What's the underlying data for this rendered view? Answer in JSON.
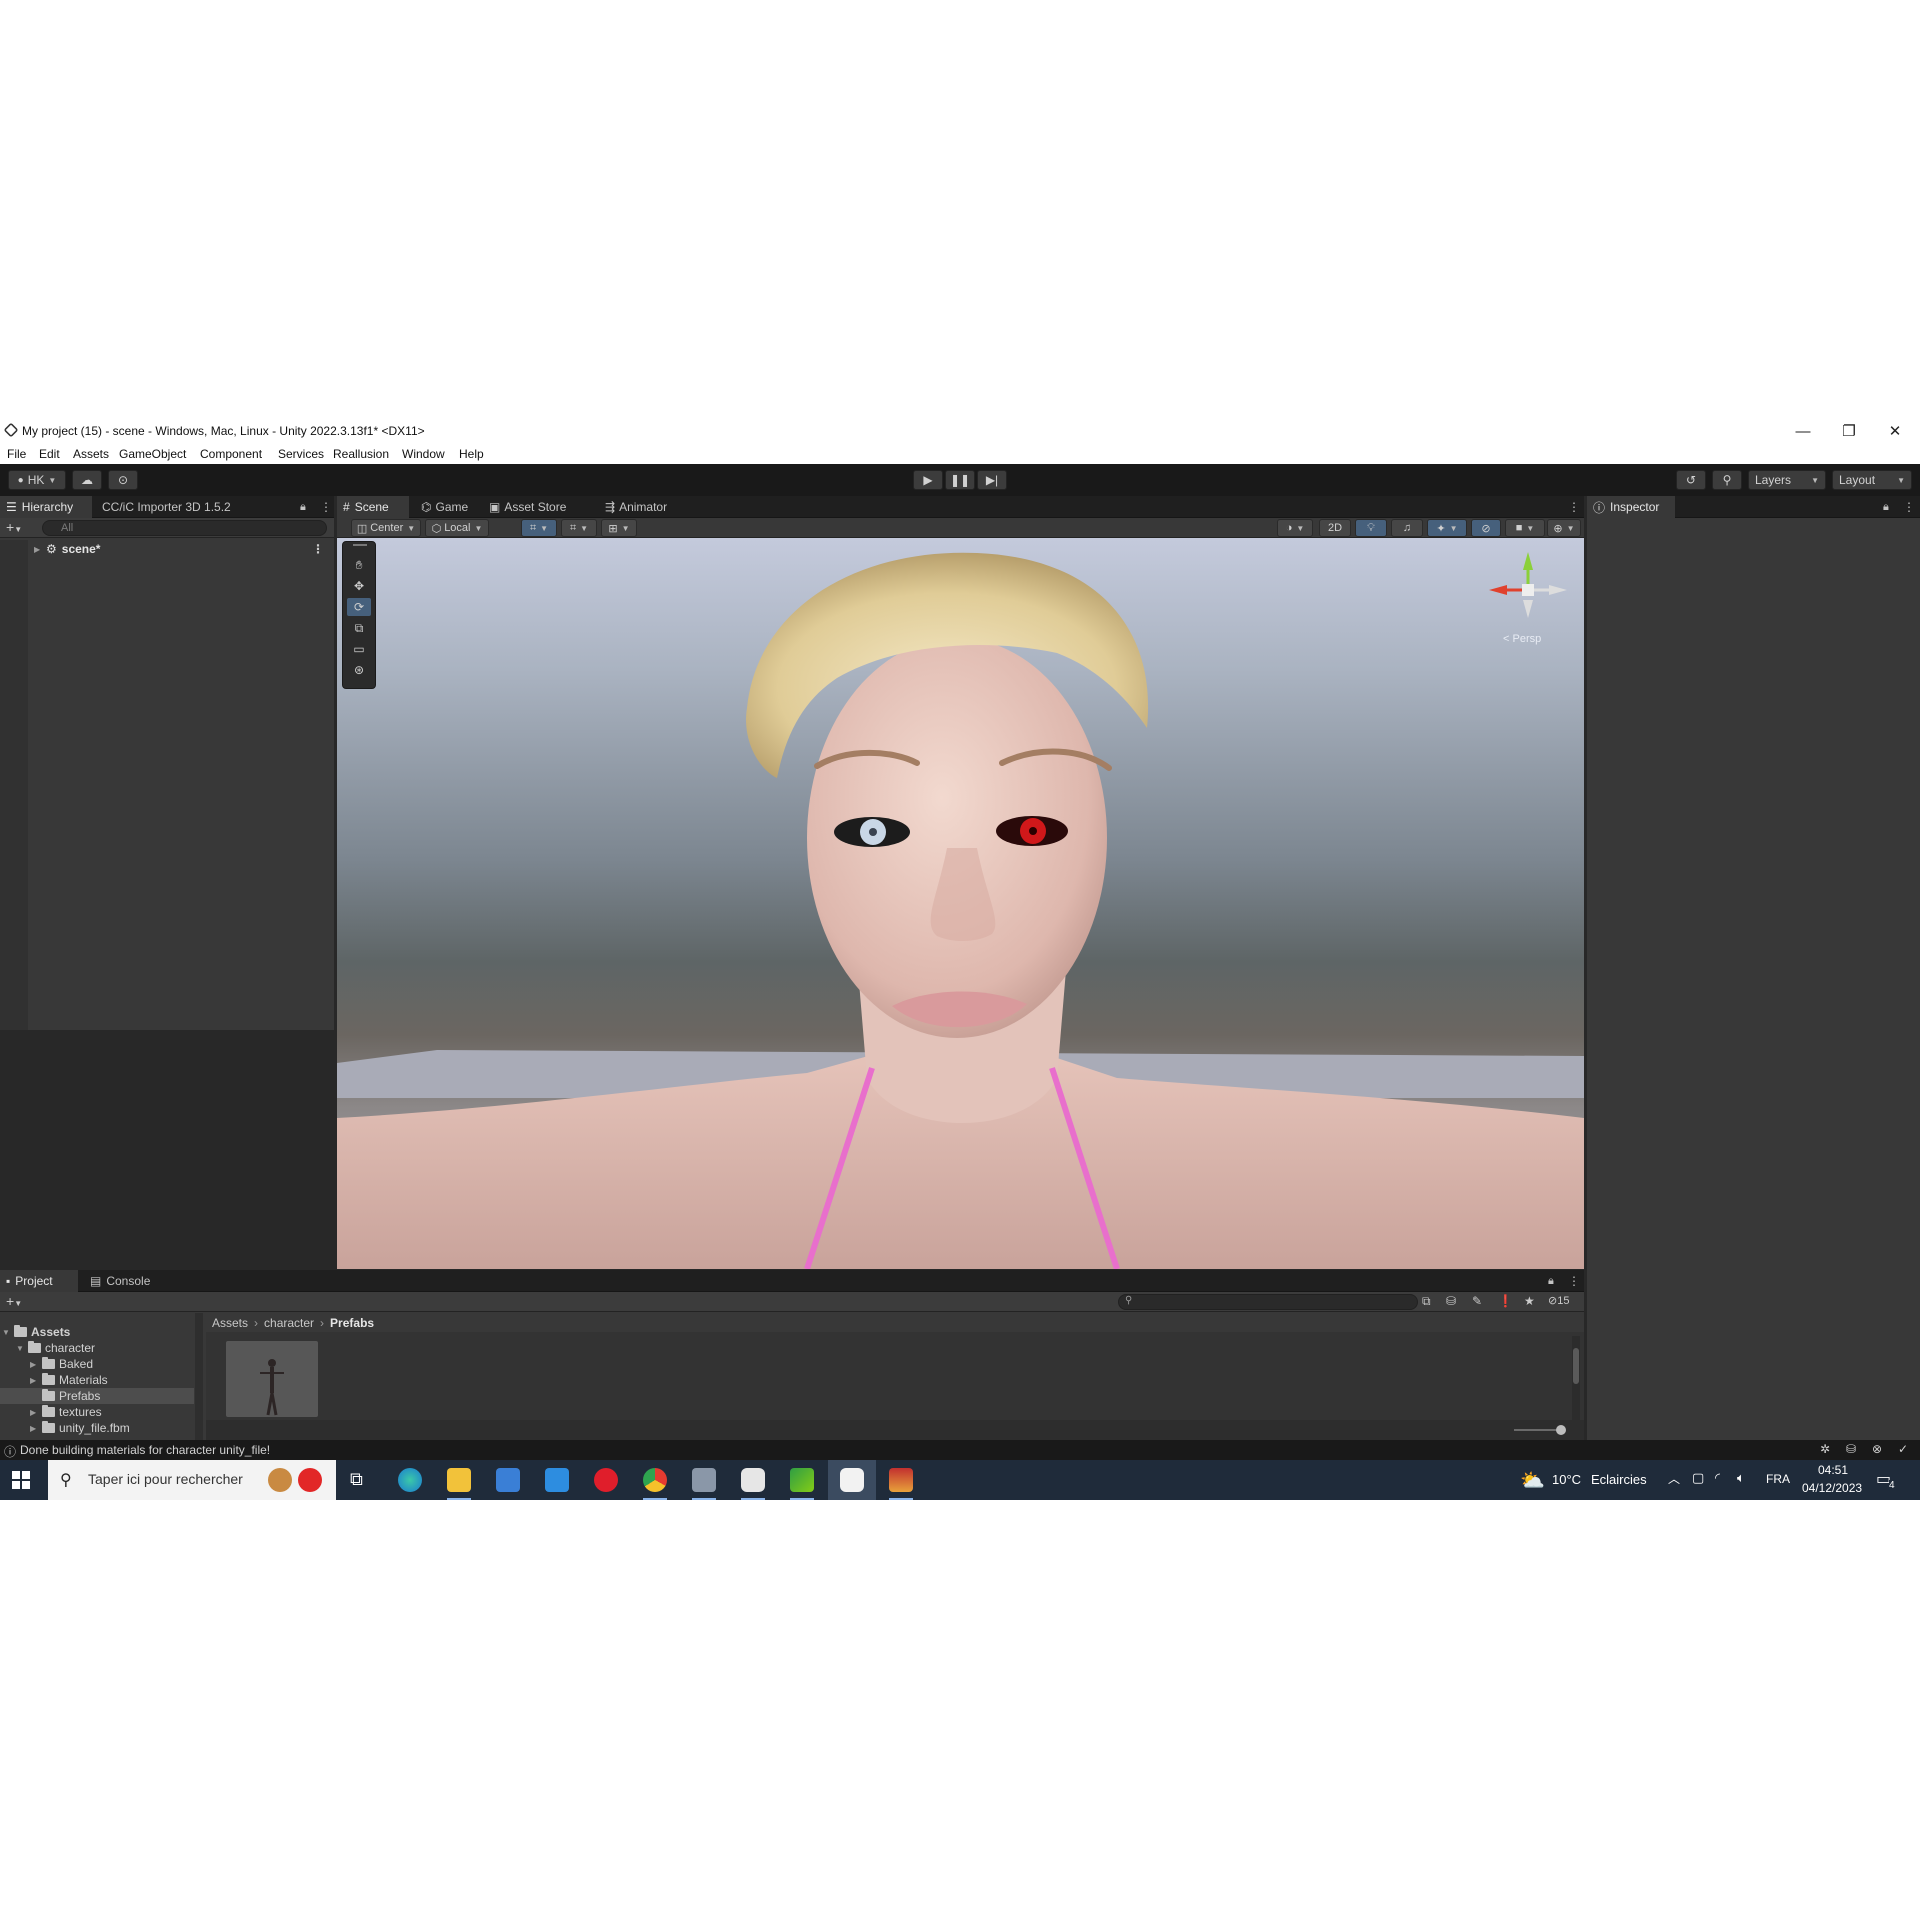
{
  "window": {
    "title": "My project (15) - scene - Windows, Mac, Linux - Unity 2022.3.13f1* <DX11>",
    "controls": {
      "minimize": "—",
      "maximize": "❐",
      "close": "✕"
    }
  },
  "menu": [
    "File",
    "Edit",
    "Assets",
    "GameObject",
    "Component",
    "Services",
    "Reallusion",
    "Window",
    "Help"
  ],
  "toolbar": {
    "account": "HK",
    "layers_label": "Layers",
    "layout_label": "Layout",
    "play_icon": "play-icon",
    "pause_icon": "pause-icon",
    "step_icon": "step-icon"
  },
  "hierarchy": {
    "tab_label": "Hierarchy",
    "second_tab_label": "CC/iC Importer 3D 1.5.2",
    "search_placeholder": "All",
    "items": [
      {
        "label": "scene*"
      }
    ]
  },
  "scene_view": {
    "tabs": [
      "Scene",
      "Game",
      "Asset Store",
      "Animator"
    ],
    "pivot_mode": "Center",
    "pivot_rotation": "Local",
    "mode_2d": "2D",
    "gizmo_label": "Persp"
  },
  "inspector": {
    "tab_label": "Inspector"
  },
  "project": {
    "tabs": [
      "Project",
      "Console"
    ],
    "breadcrumb": [
      "Assets",
      "character",
      "Prefabs"
    ],
    "hidden_count": "15",
    "tree": [
      {
        "label": "Assets",
        "depth": 0,
        "bold": true
      },
      {
        "label": "character",
        "depth": 1
      },
      {
        "label": "Baked",
        "depth": 2
      },
      {
        "label": "Materials",
        "depth": 2
      },
      {
        "label": "Prefabs",
        "depth": 2,
        "selected": true
      },
      {
        "label": "textures",
        "depth": 2
      },
      {
        "label": "unity_file.fbm",
        "depth": 2
      }
    ]
  },
  "status": {
    "message": "Done building materials for character unity_file!"
  },
  "taskbar": {
    "search_placeholder": "Taper ici pour rechercher",
    "weather_temp": "10°C",
    "weather_text": "Eclaircies",
    "language": "FRA",
    "time": "04:51",
    "date": "04/12/2023",
    "notifications": "4"
  },
  "colors": {
    "accent_selected": "#46607c",
    "editor_bg": "#383838",
    "taskbar_bg": "#1f2b3a"
  }
}
